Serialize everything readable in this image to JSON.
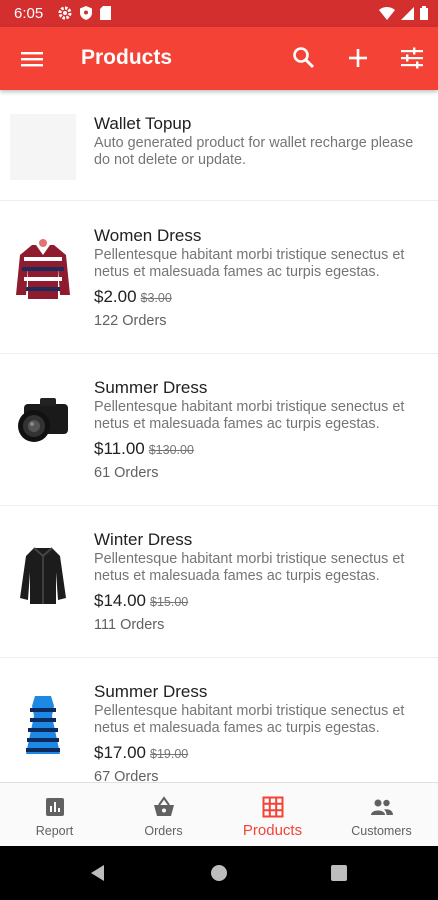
{
  "status": {
    "time": "6:05"
  },
  "appbar": {
    "title": "Products"
  },
  "products": [
    {
      "name": "Wallet Topup",
      "description": "Auto generated product for wallet recharge please do not delete or update.",
      "price": "",
      "old_price": "",
      "orders": ""
    },
    {
      "name": "Women Dress",
      "description": "Pellentesque habitant morbi tristique senectus et netus et malesuada fames ac turpis egestas.",
      "price": "$2.00",
      "old_price": "$3.00",
      "orders": "122 Orders"
    },
    {
      "name": "Summer Dress",
      "description": "Pellentesque habitant morbi tristique senectus et netus et malesuada fames ac turpis egestas.",
      "price": "$11.00",
      "old_price": "$130.00",
      "orders": "61 Orders"
    },
    {
      "name": "Winter Dress",
      "description": "Pellentesque habitant morbi tristique senectus et netus et malesuada fames ac turpis egestas.",
      "price": "$14.00",
      "old_price": "$15.00",
      "orders": "111 Orders"
    },
    {
      "name": "Summer Dress",
      "description": "Pellentesque habitant morbi tristique senectus et netus et malesuada fames ac turpis egestas.",
      "price": "$17.00",
      "old_price": "$19.00",
      "orders": "67 Orders"
    }
  ],
  "bottom_nav": [
    {
      "label": "Report",
      "icon": "bar-chart-icon"
    },
    {
      "label": "Orders",
      "icon": "basket-icon"
    },
    {
      "label": "Products",
      "icon": "grid-icon",
      "active": true
    },
    {
      "label": "Customers",
      "icon": "people-icon"
    }
  ],
  "colors": {
    "primary": "#f44336",
    "status": "#d32f2f",
    "active": "#f44336"
  }
}
